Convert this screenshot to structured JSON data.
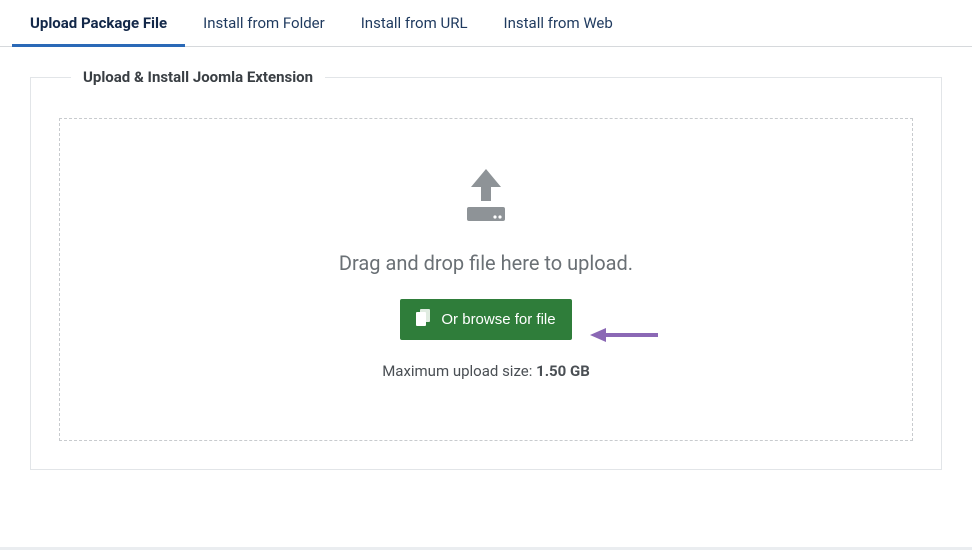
{
  "tabs": [
    {
      "label": "Upload Package File",
      "active": true
    },
    {
      "label": "Install from Folder",
      "active": false
    },
    {
      "label": "Install from URL",
      "active": false
    },
    {
      "label": "Install from Web",
      "active": false
    }
  ],
  "fieldset": {
    "legend": "Upload & Install Joomla Extension"
  },
  "dropzone": {
    "drag_text": "Drag and drop file here to upload.",
    "browse_label": "Or browse for file",
    "max_size_label": "Maximum upload size: ",
    "max_size_value": "1.50 GB"
  },
  "colors": {
    "accent": "#2a69b7",
    "button": "#2f7d3a",
    "arrow": "#8b68b5"
  }
}
